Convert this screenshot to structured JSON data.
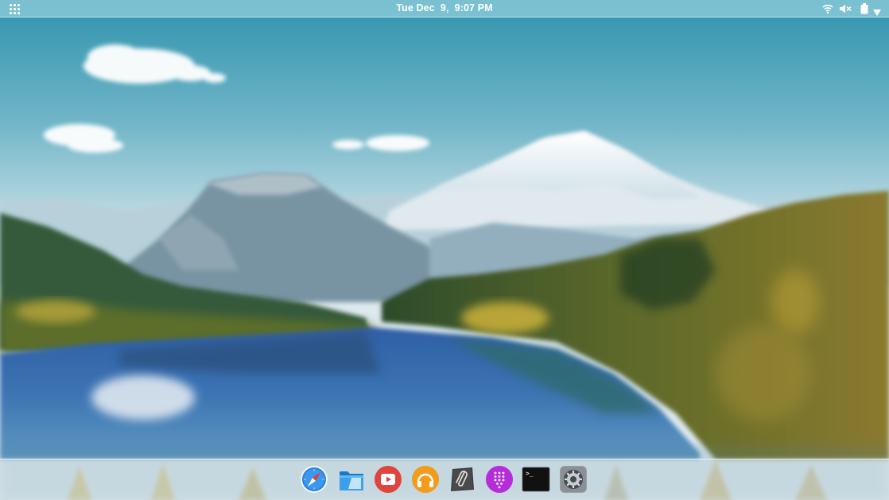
{
  "topbar": {
    "clock": "Tue Dec  9,  9:07 PM",
    "apps_menu_icon": "apps-grid-icon",
    "tray": {
      "wifi_icon": "wifi-icon",
      "volume_icon": "volume-muted-icon",
      "battery_icon": "battery-icon",
      "menu_icon": "menu-down-icon"
    }
  },
  "dock": {
    "items": [
      {
        "icon": "browser-compass-icon"
      },
      {
        "icon": "files-folder-icon"
      },
      {
        "icon": "video-player-icon"
      },
      {
        "icon": "music-headphones-icon"
      },
      {
        "icon": "notes-paperclip-icon"
      },
      {
        "icon": "app-center-icon"
      },
      {
        "icon": "terminal-icon",
        "text": ">_"
      },
      {
        "icon": "settings-gear-icon"
      }
    ]
  },
  "colors": {
    "topbar": "#80c4d4",
    "dock": "#cddce2",
    "sky_top": "#2e93ad",
    "lake": "#3c6fae",
    "video_red": "#e0443e",
    "music_orange": "#f39b1d",
    "appcenter_purple": "#b52cd9",
    "browser_blue": "#2b7fe0"
  }
}
